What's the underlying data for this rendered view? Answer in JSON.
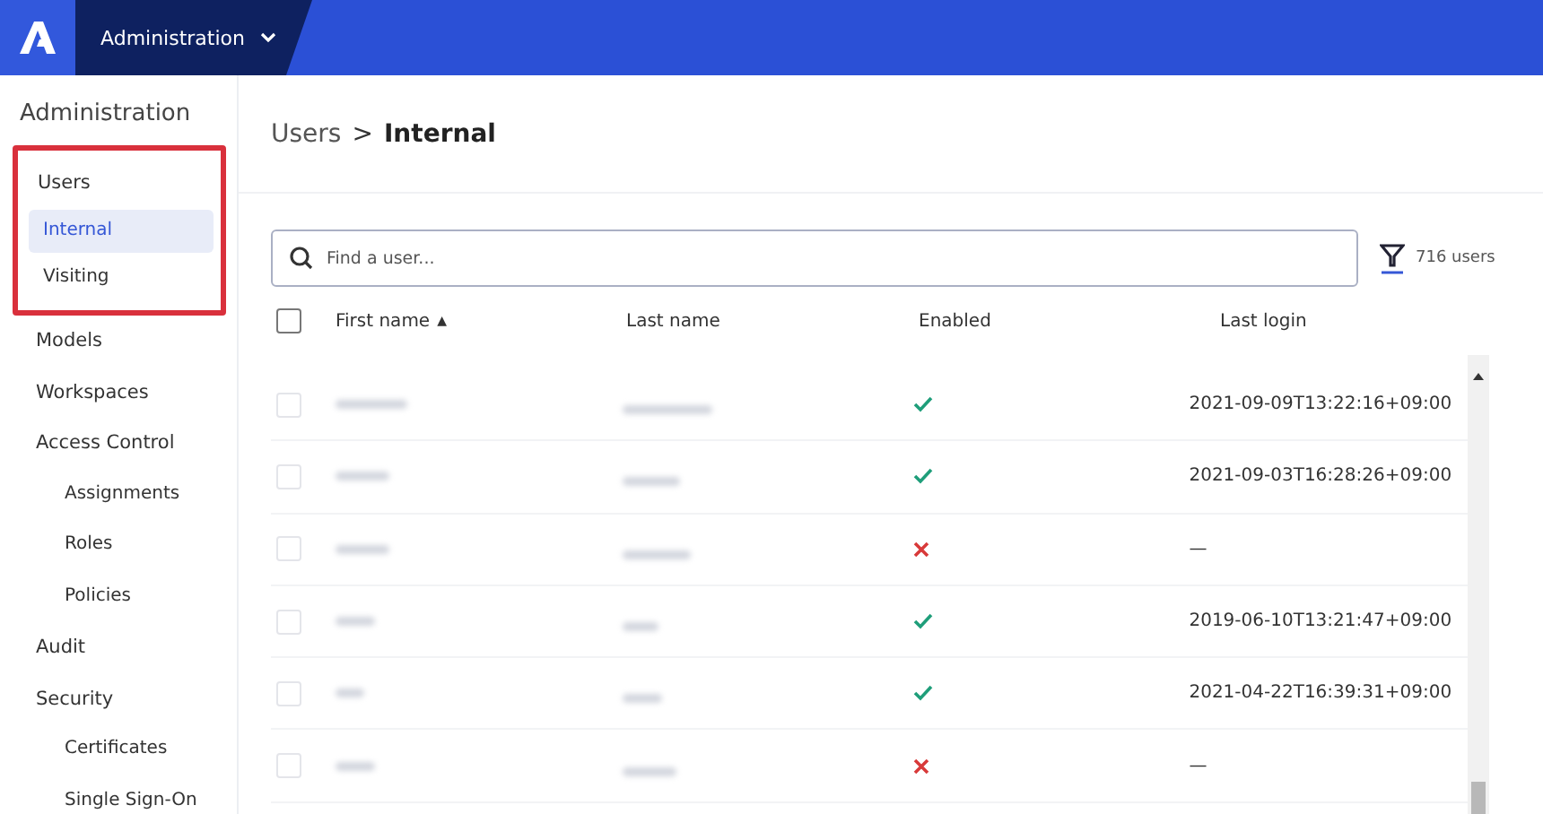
{
  "top_bar": {
    "menu_label": "Administration"
  },
  "sidebar": {
    "title": "Administration",
    "items": [
      {
        "label": "Users",
        "selected": false,
        "highlighted": true,
        "children": [
          {
            "label": "Internal",
            "selected": true
          },
          {
            "label": "Visiting",
            "selected": false
          }
        ]
      },
      {
        "label": "Models",
        "selected": false
      },
      {
        "label": "Workspaces",
        "selected": false
      },
      {
        "label": "Access Control",
        "selected": false,
        "children": [
          {
            "label": "Assignments",
            "selected": false
          },
          {
            "label": "Roles",
            "selected": false
          },
          {
            "label": "Policies",
            "selected": false
          }
        ]
      },
      {
        "label": "Audit",
        "selected": false
      },
      {
        "label": "Security",
        "selected": false,
        "children": [
          {
            "label": "Certificates",
            "selected": false
          },
          {
            "label": "Single Sign-On",
            "selected": false
          }
        ]
      }
    ]
  },
  "breadcrumb": {
    "parent": "Users",
    "separator": ">",
    "current": "Internal"
  },
  "search": {
    "placeholder": "Find a user..."
  },
  "user_count": "716 users",
  "table": {
    "columns": [
      "First name",
      "Last name",
      "Enabled",
      "Last login"
    ],
    "sort_mark": "▲",
    "all_checked": false,
    "rows": [
      {
        "checked": false,
        "enabled": true,
        "last_login": "2021-09-09T13:22:16+09:00"
      },
      {
        "checked": false,
        "enabled": true,
        "last_login": "2021-09-03T16:28:26+09:00"
      },
      {
        "checked": false,
        "enabled": false,
        "last_login": "—"
      },
      {
        "checked": false,
        "enabled": true,
        "last_login": "2019-06-10T13:21:47+09:00"
      },
      {
        "checked": false,
        "enabled": true,
        "last_login": "2021-04-22T16:39:31+09:00"
      },
      {
        "checked": false,
        "enabled": false,
        "last_login": "—"
      }
    ]
  }
}
